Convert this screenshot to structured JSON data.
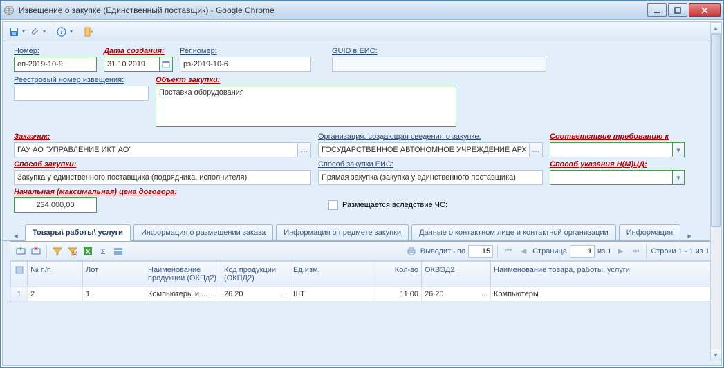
{
  "window": {
    "title": "Извещение о закупке (Единственный поставщик) - Google Chrome"
  },
  "fields": {
    "number_label": "Номер:",
    "number_value": "еп-2019-10-9",
    "create_date_label": "Дата создания:",
    "create_date_value": "31.10.2019",
    "reg_number_label": "Рег.номер:",
    "reg_number_value": "рз-2019-10-6",
    "guid_label": "GUID в ЕИС:",
    "guid_value": "",
    "registry_no_label": "Реестровый номер извещения:",
    "registry_no_value": "",
    "object_label": "Объект закупки:",
    "object_value": "Поставка оборудования",
    "customer_label": "Заказчик:",
    "customer_value": "ГАУ АО \"УПРАВЛЕНИЕ ИКТ АО\"",
    "org_label": "Организация, создающая сведения о закупке:",
    "org_value": "ГОСУДАРСТВЕННОЕ АВТОНОМНОЕ УЧРЕЖДЕНИЕ АРХАН",
    "compliance_label": "Соответствие требованию к",
    "compliance_value": "",
    "method_label": "Способ закупки:",
    "method_value": "Закупка у единственного поставщика (подрядчика, исполнителя)",
    "method_eis_label": "Способ закупки ЕИС:",
    "method_eis_value": "Прямая закупка (закупка у единственного поставщика)",
    "nmcd_label": "Способ указания Н(М)ЦД:",
    "nmcd_value": "",
    "price_label": "Начальная (максимальная) цена договора:",
    "price_value": "234 000,00",
    "chs_label": "Размещается вследствие ЧС:"
  },
  "tabs": [
    "Товары\\ работы\\ услуги",
    "Информация о размещении заказа",
    "Информация о предмете закупки",
    "Данные о контактном лице и контактной организации",
    "Информация"
  ],
  "grid_toolbar": {
    "show_by": "Выводить по",
    "show_by_value": "15",
    "page_label": "Страница",
    "page_value": "1",
    "page_of": "из 1",
    "rows_info": "Строки 1 - 1 из 1"
  },
  "grid": {
    "headers": {
      "npp": "№ п/п",
      "lot": "Лот",
      "name_okpd2": "Наименование продукции (ОКПд2)",
      "code_okpd2": "Код продукции (ОКПД2)",
      "unit": "Ед.изм.",
      "qty": "Кол-во",
      "okved2": "ОКВЭД2",
      "product_name": "Наименование товара, работы, услуги"
    },
    "rows": [
      {
        "rownum": "1",
        "npp": "2",
        "lot": "1",
        "name_okpd2": "Компьютеры и ...",
        "code_okpd2": "26.20",
        "unit": "ШТ",
        "qty": "11,00",
        "okved2": "26.20",
        "product_name": "Компьютеры"
      }
    ]
  }
}
